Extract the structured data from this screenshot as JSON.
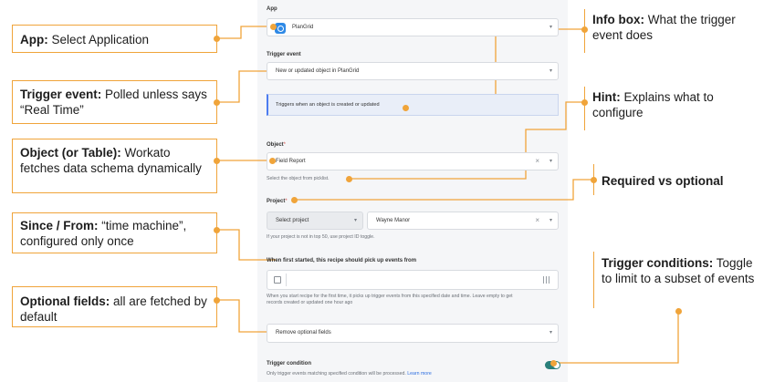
{
  "callouts": {
    "app": {
      "title": "App:",
      "text": " Select Application"
    },
    "trigger_event": {
      "title": "Trigger event:",
      "text": " Polled unless says “Real Time”"
    },
    "object": {
      "title": "Object (or Table):",
      "text": " Workato fetches data schema dynamically"
    },
    "since": {
      "title": "Since / From:",
      "text": " “time machine”, configured only once"
    },
    "optional": {
      "title": "Optional fields:",
      "text": " all are fetched by default"
    },
    "info_box": {
      "title": "Info box:",
      "text": " What the trigger event does"
    },
    "hint": {
      "title": "Hint:",
      "text": " Explains what to configure"
    },
    "required": {
      "title": "Required vs optional",
      "text": ""
    },
    "conditions": {
      "title": "Trigger conditions:",
      "text": " Toggle to limit to a subset of events"
    }
  },
  "form": {
    "app_label": "App",
    "app_value": "PlanGrid",
    "trigger_label": "Trigger event",
    "trigger_value": "New or updated object in PlanGrid",
    "info_text": "Triggers when an object is created or updated",
    "object_label": "Object",
    "object_value": "Field Report",
    "object_hint": "Select the object from picklist.",
    "project_label": "Project",
    "project_select": "Select project",
    "project_value": "Wayne Manor",
    "project_hint": "If your project is not in top 50, use project ID toggle.",
    "since_label": "When first started, this recipe should pick up events from",
    "since_hint_1": "When you start recipe for the first time, it picks up trigger events from this specified date and time. Leave empty to get",
    "since_hint_2": "records created or updated one hour ago",
    "optional_value": "Remove optional fields",
    "condition_label": "Trigger condition",
    "condition_hint": "Only trigger events matching specified condition will be processed.",
    "learn_more": "Learn more",
    "required_mark": "*"
  },
  "colors": {
    "accent": "#f0a43a",
    "info_bar": "#4c7cf0",
    "toggle": "#2a7f7a"
  }
}
